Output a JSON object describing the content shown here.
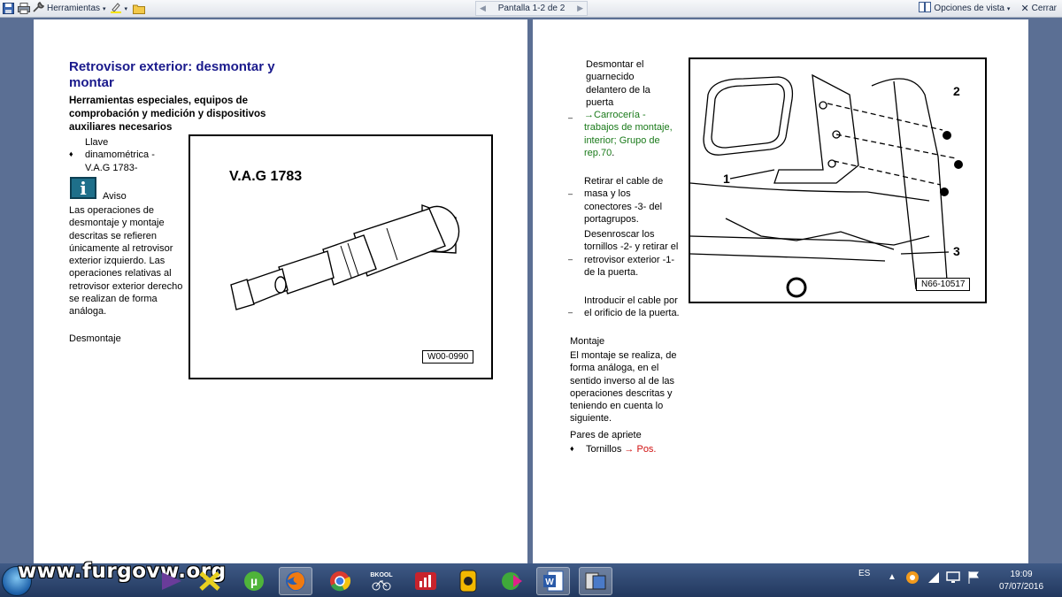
{
  "toolbar": {
    "tools_label": "Herramientas",
    "page_indicator": "Pantalla 1-2 de 2",
    "view_options_label": "Opciones de vista",
    "close_label": "Cerrar"
  },
  "left_page": {
    "title": "Retrovisor exterior: desmontar y montar",
    "subtitle": "Herramientas especiales, equipos de comprobación y medición y dispositivos auxiliares necesarios",
    "tool_item": "Llave dinamométrica - V.A.G 1783-",
    "notice_label": "Aviso",
    "notice_text": "Las operaciones de desmontaje y montaje descritas se refieren únicamente al retrovisor exterior izquierdo. Las operaciones relativas al retrovisor exterior derecho se realizan de forma análoga.",
    "section_removal": "Desmontaje",
    "figure_title": "V.A.G 1783",
    "figure_code": "W00-0990"
  },
  "right_page": {
    "step1": "Desmontar el guarnecido delantero de la puerta",
    "step2_link": "→Carrocería - trabajos de montaje, interior; Grupo de rep.70",
    "step2_end": ".",
    "step3": "Retirar el cable de masa y los conectores -3- del portagrupos.",
    "step4": "Desenroscar los tornillos -2- y retirar el retrovisor exterior -1- de la puerta.",
    "step5": "Introducir el cable por el orificio de la puerta.",
    "section_assembly": "Montaje",
    "assembly_text": "El montaje se realiza, de forma análoga, en el sentido inverso al de las operaciones descritas y teniendo en cuenta lo siguiente.",
    "torque_heading": "Pares de apriete",
    "torque_item": "Tornillos",
    "torque_link": "→ Pos.",
    "figure_code": "N66-10517",
    "callout_1": "1",
    "callout_2": "2",
    "callout_3": "3"
  },
  "taskbar": {
    "watermark": "www.furgovw.org",
    "bkool_label": "BKOOL",
    "language": "ES",
    "time": "19:09",
    "date": "07/07/2016"
  }
}
